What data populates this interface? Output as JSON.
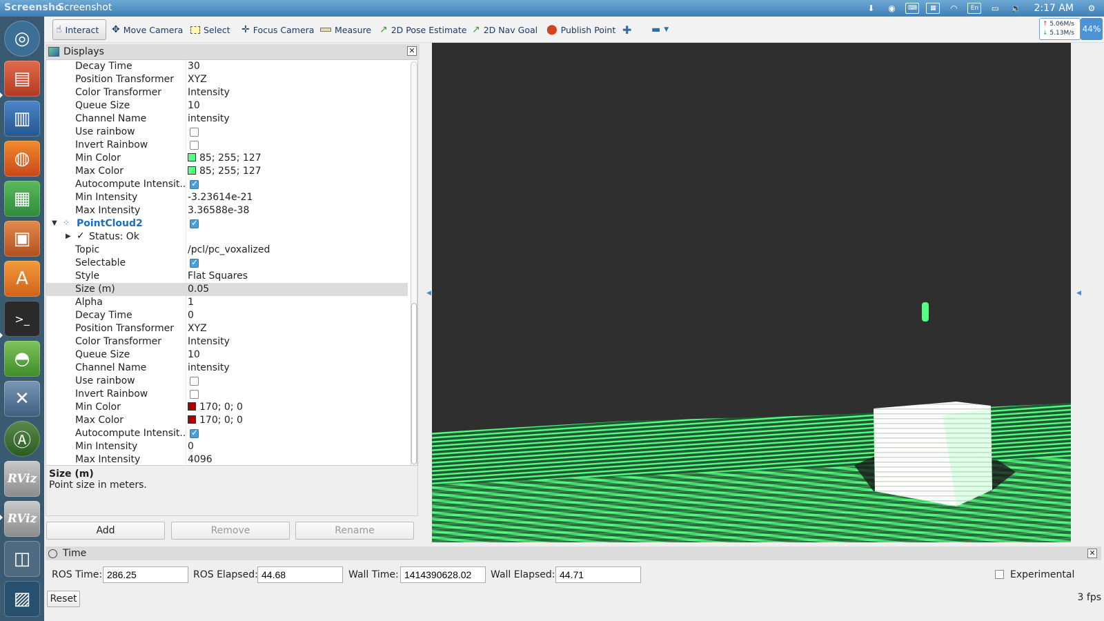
{
  "topbar": {
    "window_title": "Screensho",
    "app_title": "Screenshot",
    "keyboard_layout": "En",
    "clock": "2:17 AM"
  },
  "toolbar": {
    "tools": [
      {
        "label": "Interact",
        "icon": "hand-icon"
      },
      {
        "label": "Move Camera",
        "icon": "move-icon"
      },
      {
        "label": "Select",
        "icon": "select-icon"
      },
      {
        "label": "Focus Camera",
        "icon": "focus-icon"
      },
      {
        "label": "Measure",
        "icon": "ruler-icon"
      },
      {
        "label": "2D Pose Estimate",
        "icon": "arrow-icon"
      },
      {
        "label": "2D Nav Goal",
        "icon": "arrow-icon"
      },
      {
        "label": "Publish Point",
        "icon": "pin-icon"
      }
    ],
    "net_up": "5.06M/s",
    "net_down": "5.13M/s",
    "battery": "44%"
  },
  "displays": {
    "title": "Displays",
    "rows": [
      {
        "name": "Decay Time",
        "value": "30"
      },
      {
        "name": "Position Transformer",
        "value": "XYZ"
      },
      {
        "name": "Color Transformer",
        "value": "Intensity"
      },
      {
        "name": "Queue Size",
        "value": "10"
      },
      {
        "name": "Channel Name",
        "value": "intensity"
      },
      {
        "name": "Use rainbow",
        "checked": false
      },
      {
        "name": "Invert Rainbow",
        "checked": false
      },
      {
        "name": "Min Color",
        "value": "85; 255; 127",
        "color": "#55ff7f"
      },
      {
        "name": "Max Color",
        "value": "85; 255; 127",
        "color": "#55ff7f"
      },
      {
        "name": "Autocompute Intensit...",
        "checked": true
      },
      {
        "name": "Min Intensity",
        "value": "-3.23614e-21"
      },
      {
        "name": "Max Intensity",
        "value": "3.36588e-38"
      },
      {
        "name": "PointCloud2",
        "checked": true
      },
      {
        "name": "Status: Ok"
      },
      {
        "name": "Topic",
        "value": "/pcl/pc_voxalized"
      },
      {
        "name": "Selectable",
        "checked": true
      },
      {
        "name": "Style",
        "value": "Flat Squares"
      },
      {
        "name": "Size (m)",
        "value": "0.05"
      },
      {
        "name": "Alpha",
        "value": "1"
      },
      {
        "name": "Decay Time",
        "value": "0"
      },
      {
        "name": "Position Transformer",
        "value": "XYZ"
      },
      {
        "name": "Color Transformer",
        "value": "Intensity"
      },
      {
        "name": "Queue Size",
        "value": "10"
      },
      {
        "name": "Channel Name",
        "value": "intensity"
      },
      {
        "name": "Use rainbow",
        "checked": false
      },
      {
        "name": "Invert Rainbow",
        "checked": false
      },
      {
        "name": "Min Color",
        "value": "170; 0; 0",
        "color": "#aa0000"
      },
      {
        "name": "Max Color",
        "value": "170; 0; 0",
        "color": "#aa0000"
      },
      {
        "name": "Autocompute Intensit...",
        "checked": true
      },
      {
        "name": "Min Intensity",
        "value": "0"
      },
      {
        "name": "Max Intensity",
        "value": "4096"
      }
    ],
    "description_title": "Size (m)",
    "description_text": "Point size in meters.",
    "add_label": "Add",
    "remove_label": "Remove",
    "rename_label": "Rename"
  },
  "time": {
    "title": "Time",
    "ros_time_label": "ROS Time:",
    "ros_time": "286.25",
    "ros_elapsed_label": "ROS Elapsed:",
    "ros_elapsed": "44.68",
    "wall_time_label": "Wall Time:",
    "wall_time": "1414390628.02",
    "wall_elapsed_label": "Wall Elapsed:",
    "wall_elapsed": "44.71",
    "experimental_label": "Experimental",
    "reset_label": "Reset",
    "fps": "3 fps"
  },
  "colors": {
    "point_green": "#55ff7f",
    "view_background": "#2f2f2f",
    "accent_blue": "#1b6fc5"
  }
}
